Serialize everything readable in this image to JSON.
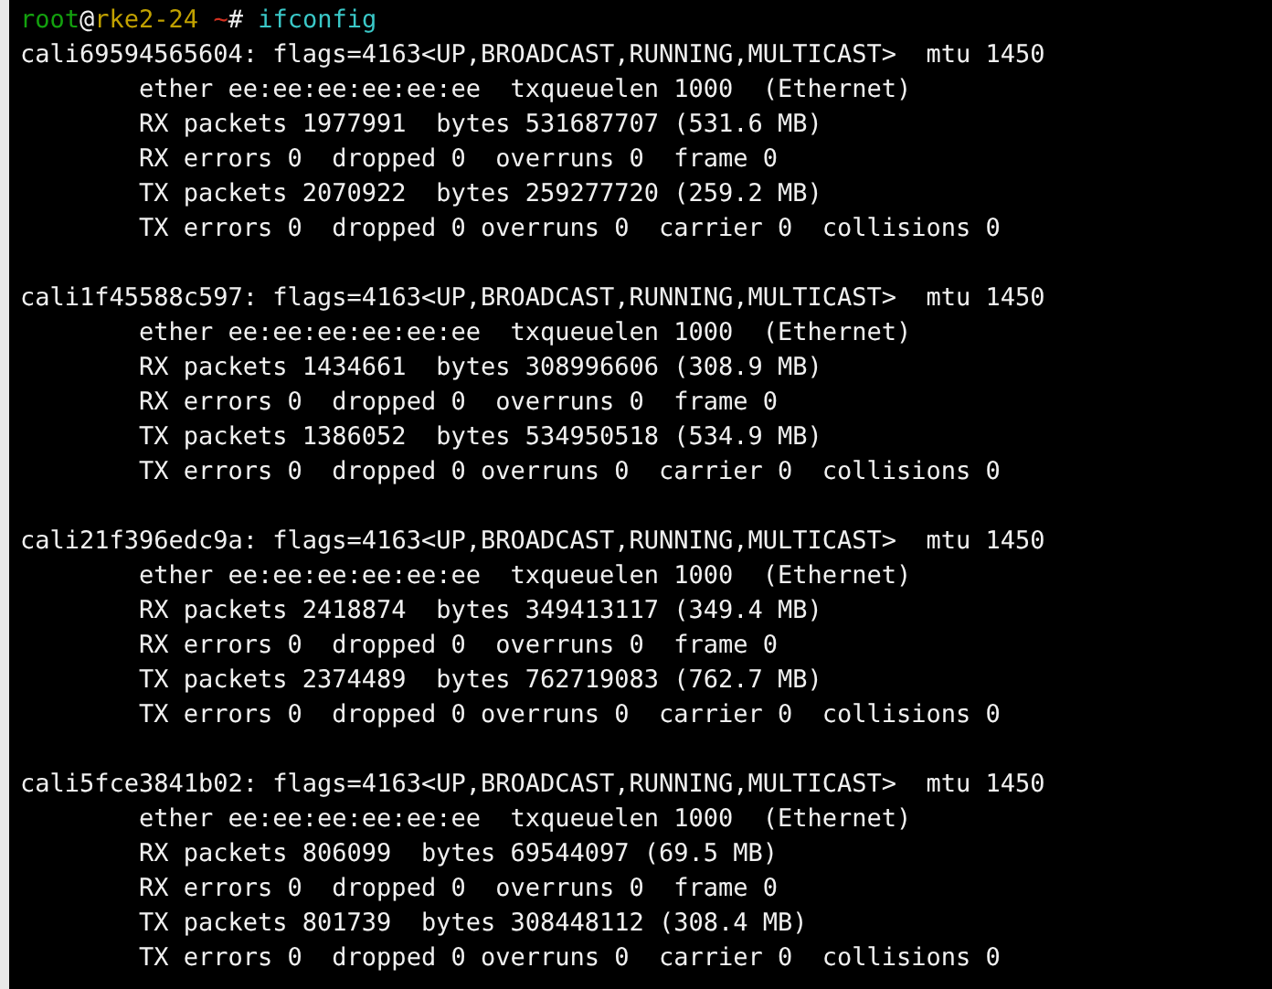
{
  "prompt": {
    "user": "root",
    "at": "@",
    "host": "rke2-24",
    "path": "~",
    "symbol": "#",
    "command": "ifconfig"
  },
  "interfaces": [
    {
      "header": "cali69594565604: flags=4163<UP,BROADCAST,RUNNING,MULTICAST>  mtu 1450",
      "details": [
        "ether ee:ee:ee:ee:ee:ee  txqueuelen 1000  (Ethernet)",
        "RX packets 1977991  bytes 531687707 (531.6 MB)",
        "RX errors 0  dropped 0  overruns 0  frame 0",
        "TX packets 2070922  bytes 259277720 (259.2 MB)",
        "TX errors 0  dropped 0 overruns 0  carrier 0  collisions 0"
      ]
    },
    {
      "header": "cali1f45588c597: flags=4163<UP,BROADCAST,RUNNING,MULTICAST>  mtu 1450",
      "details": [
        "ether ee:ee:ee:ee:ee:ee  txqueuelen 1000  (Ethernet)",
        "RX packets 1434661  bytes 308996606 (308.9 MB)",
        "RX errors 0  dropped 0  overruns 0  frame 0",
        "TX packets 1386052  bytes 534950518 (534.9 MB)",
        "TX errors 0  dropped 0 overruns 0  carrier 0  collisions 0"
      ]
    },
    {
      "header": "cali21f396edc9a: flags=4163<UP,BROADCAST,RUNNING,MULTICAST>  mtu 1450",
      "details": [
        "ether ee:ee:ee:ee:ee:ee  txqueuelen 1000  (Ethernet)",
        "RX packets 2418874  bytes 349413117 (349.4 MB)",
        "RX errors 0  dropped 0  overruns 0  frame 0",
        "TX packets 2374489  bytes 762719083 (762.7 MB)",
        "TX errors 0  dropped 0 overruns 0  carrier 0  collisions 0"
      ]
    },
    {
      "header": "cali5fce3841b02: flags=4163<UP,BROADCAST,RUNNING,MULTICAST>  mtu 1450",
      "details": [
        "ether ee:ee:ee:ee:ee:ee  txqueuelen 1000  (Ethernet)",
        "RX packets 806099  bytes 69544097 (69.5 MB)",
        "RX errors 0  dropped 0  overruns 0  frame 0",
        "TX packets 801739  bytes 308448112 (308.4 MB)",
        "TX errors 0  dropped 0 overruns 0  carrier 0  collisions 0"
      ]
    }
  ]
}
